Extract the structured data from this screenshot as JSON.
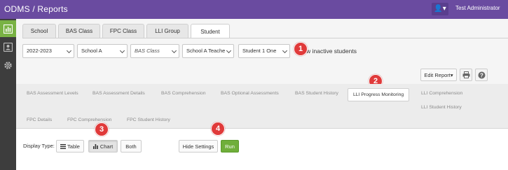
{
  "app": {
    "brand": "ODMS / Reports",
    "user_name": "Test Administrator"
  },
  "sidebar": {
    "items": [
      {
        "icon": "chart-icon",
        "active": true
      },
      {
        "icon": "contact-card-icon",
        "active": false
      },
      {
        "icon": "gear-icon",
        "active": false
      }
    ]
  },
  "top_tabs": [
    "School",
    "BAS Class",
    "FPC Class",
    "LLI Group",
    "Student"
  ],
  "filters": {
    "year": "2022-2023",
    "school": "School A",
    "class": "BAS Class",
    "teacher": "School A Teache",
    "student": "Student 1 One",
    "show_inactive": "Show inactive students"
  },
  "toolbar": {
    "edit_report": "Edit Report"
  },
  "report_tabs": [
    "BAS Assessment Levels",
    "BAS Assessment Details",
    "BAS Comprehension",
    "BAS Optional Assessments",
    "BAS Student History",
    "LLI Progress Monitoring",
    "LLI Comprehension",
    "LLI Student History",
    "FPC Details",
    "FPC Comprehension",
    "FPC Student History"
  ],
  "display": {
    "label": "Display Type:",
    "table": "Table",
    "chart": "Chart",
    "both": "Both",
    "hide_settings": "Hide Settings",
    "run": "Run"
  },
  "callouts": [
    "1",
    "2",
    "3",
    "4"
  ],
  "colors": {
    "topbar": "#6a4ba0",
    "sidebar": "#3d3d3d",
    "sidebar_active": "#79b244",
    "run": "#6fae3a",
    "callout": "#e03a3a"
  }
}
